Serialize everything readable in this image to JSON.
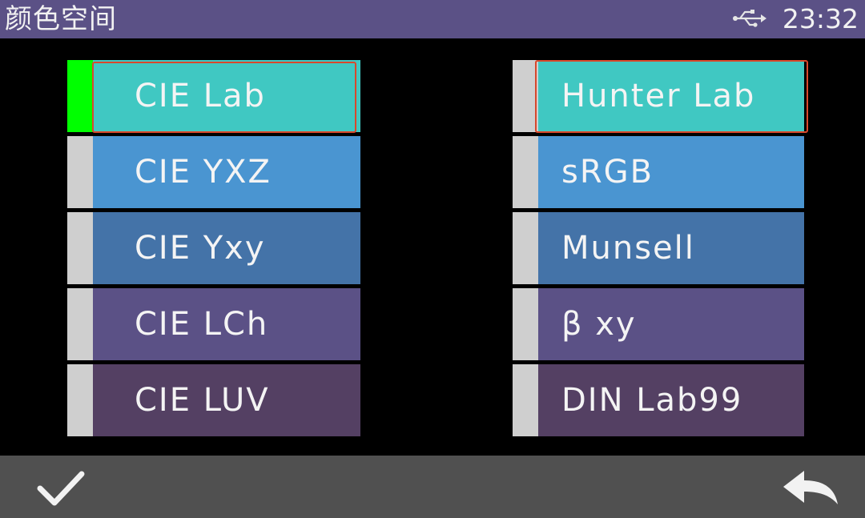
{
  "header": {
    "title": "颜色空间",
    "usb_icon": "usb-icon",
    "time": "23:32"
  },
  "options": {
    "left": [
      {
        "label": "CIE Lab",
        "color": "#40c8c2",
        "selected": true,
        "focused": true
      },
      {
        "label": "CIE YXZ",
        "color": "#4a95d1",
        "selected": false,
        "focused": false
      },
      {
        "label": "CIE Yxy",
        "color": "#4473a8",
        "selected": false,
        "focused": false
      },
      {
        "label": "CIE LCh",
        "color": "#5b5186",
        "selected": false,
        "focused": false
      },
      {
        "label": "CIE LUV",
        "color": "#544063",
        "selected": false,
        "focused": false
      }
    ],
    "right": [
      {
        "label": "Hunter Lab",
        "color": "#40c8c2",
        "selected": false,
        "focused": true
      },
      {
        "label": "sRGB",
        "color": "#4a95d1",
        "selected": false,
        "focused": false
      },
      {
        "label": "Munsell",
        "color": "#4473a8",
        "selected": false,
        "focused": false
      },
      {
        "label": "β xy",
        "color": "#5b5186",
        "selected": false,
        "focused": false
      },
      {
        "label": "DIN Lab99",
        "color": "#544063",
        "selected": false,
        "focused": false
      }
    ]
  },
  "colors": {
    "title_bar": "#5b5186",
    "selected_indicator": "#00ff00",
    "unselected_indicator": "#cfcfcf",
    "focus_border": "#d9482b",
    "bottom_bar": "#505050"
  },
  "footer": {
    "confirm_icon": "checkmark-icon",
    "back_icon": "back-arrow-icon"
  }
}
